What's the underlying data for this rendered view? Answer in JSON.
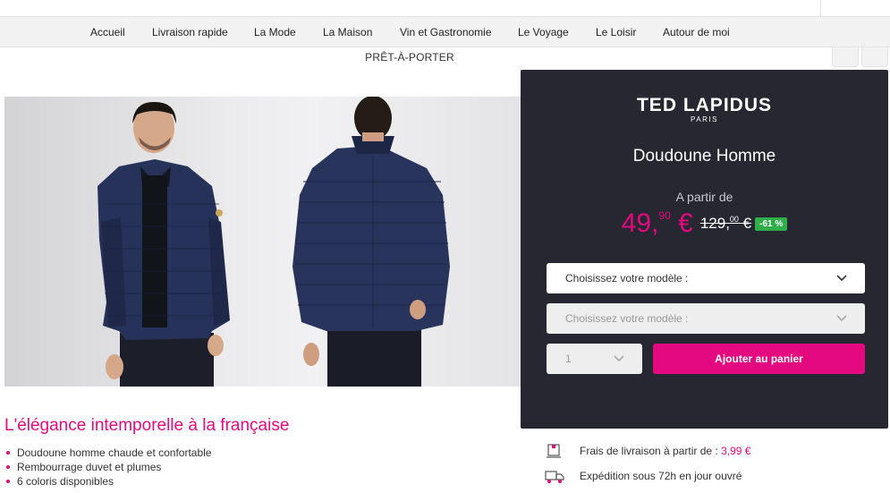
{
  "nav": {
    "items": [
      "Accueil",
      "Livraison rapide",
      "La Mode",
      "La Maison",
      "Vin et Gastronomie",
      "Le Voyage",
      "Le Loisir",
      "Autour de moi"
    ]
  },
  "breadcrumb": "PRÊT-À-PORTER",
  "hero": {
    "headline": "L'élégance intemporelle à la française",
    "bullets": [
      "Doudoune homme chaude et confortable",
      "Rembourrage duvet et plumes",
      "6 coloris disponibles"
    ]
  },
  "product": {
    "brand": "TED LAPIDUS",
    "brand_city": "PARIS",
    "title": "Doudoune Homme",
    "from_label": "A partir de",
    "price_int": "49,",
    "price_cents": "90",
    "price_currency": "€",
    "old_price_int": "129,",
    "old_price_cents": "00",
    "old_price_currency": "€",
    "discount": "-61 %",
    "model_select_1": "Choisissez votre modèle :",
    "model_select_2": "Choisissez votre modèle :",
    "quantity": "1",
    "add_to_cart": "Ajouter au panier"
  },
  "shipping": {
    "delivery_label": "Frais de livraison à partir de :",
    "delivery_price": "3,99 €",
    "dispatch_label": "Expédition sous 72h en jour ouvré"
  },
  "colors": {
    "accent": "#e5097f",
    "panel": "#262730",
    "discount": "#2fae4a",
    "jacket": "#26335a"
  }
}
